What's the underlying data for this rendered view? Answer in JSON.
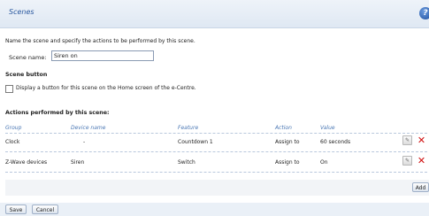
{
  "header": {
    "title": "Scenes",
    "help_icon": "help-icon"
  },
  "intro": "Name the scene and specify the actions to be performed by this scene.",
  "scene_name": {
    "label": "Scene name:",
    "value": "Siren on"
  },
  "scene_button": {
    "title": "Scene button",
    "checkbox_label": "Display a button for this scene on the Home screen of the e-Centre.",
    "checked": false
  },
  "actions": {
    "title": "Actions performed by this scene:",
    "columns": [
      "Group",
      "Device name",
      "Feature",
      "Action",
      "Value"
    ],
    "rows": [
      {
        "group": "Clock",
        "device": "-",
        "feature": "Countdown 1",
        "action": "Assign to",
        "value": "60 seconds"
      },
      {
        "group": "Z-Wave devices",
        "device": "Siren",
        "feature": "Switch",
        "action": "Assign to",
        "value": "On"
      }
    ],
    "row_icons": [
      "edit-icon",
      "delete-icon"
    ],
    "add_label": "Add"
  },
  "footer": {
    "save_label": "Save",
    "cancel_label": "Cancel"
  },
  "colors": {
    "accent": "#2c5aa0",
    "header_text": "#4a77b4",
    "delete": "#d01010"
  }
}
